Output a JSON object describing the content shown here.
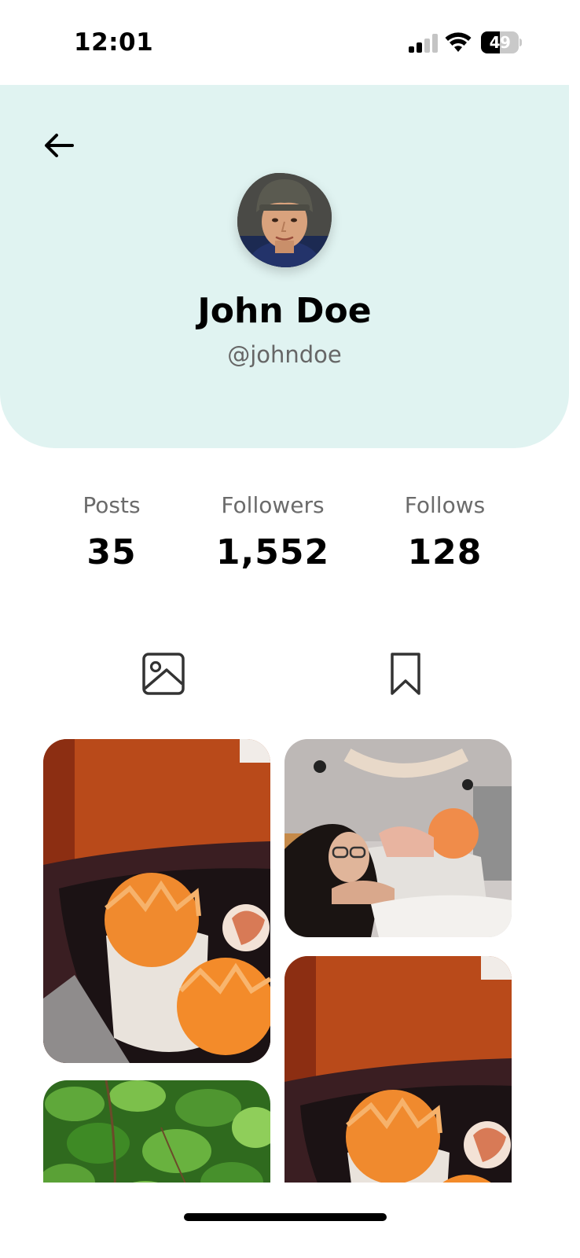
{
  "status_bar": {
    "time": "12:01",
    "battery_level": "49",
    "battery_fraction": 0.49,
    "signal_icon": "cellular-signal-icon",
    "wifi_icon": "wifi-icon"
  },
  "profile": {
    "name": "John Doe",
    "handle": "@johndoe",
    "header_color": "#e0f3f1"
  },
  "stats": [
    {
      "label": "Posts",
      "value": "35"
    },
    {
      "label": "Followers",
      "value": "1,552"
    },
    {
      "label": "Follows",
      "value": "128"
    }
  ],
  "tabs": [
    {
      "icon": "image-icon",
      "selected": true
    },
    {
      "icon": "bookmark-icon",
      "selected": false
    }
  ],
  "posts": [
    {
      "subject": "carved orange fruit in dark bowl"
    },
    {
      "subject": "girl with glasses resting on pillow"
    },
    {
      "subject": "carved orange fruit in dark bowl"
    },
    {
      "subject": "green leaves"
    }
  ]
}
